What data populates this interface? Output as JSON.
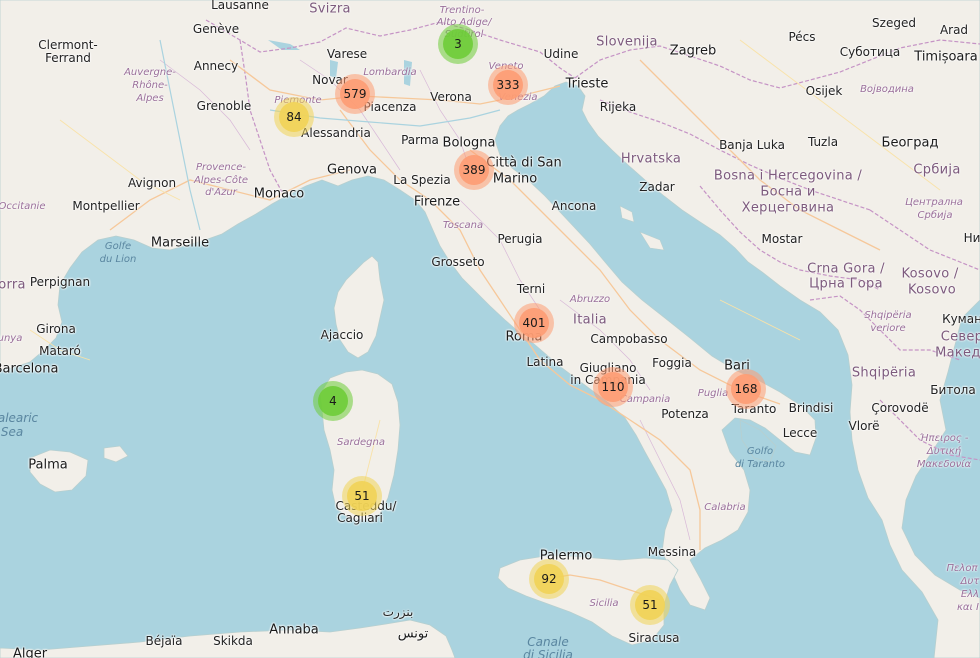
{
  "colors": {
    "sea": "#aad3df",
    "land": "#f2efe9",
    "cluster_small": "#6ecc39",
    "cluster_medium": "#f1d357",
    "cluster_large": "#fd9c73"
  },
  "clusters": [
    {
      "count": "3",
      "size": "small"
    },
    {
      "count": "579",
      "size": "large"
    },
    {
      "count": "333",
      "size": "large"
    },
    {
      "count": "84",
      "size": "medium"
    },
    {
      "count": "389",
      "size": "large"
    },
    {
      "count": "401",
      "size": "large"
    },
    {
      "count": "110",
      "size": "large"
    },
    {
      "count": "168",
      "size": "large"
    },
    {
      "count": "4",
      "size": "small"
    },
    {
      "count": "51",
      "size": "medium"
    },
    {
      "count": "92",
      "size": "medium"
    },
    {
      "count": "51",
      "size": "medium"
    }
  ],
  "countries": {
    "svizra": "Svizra",
    "slovenija": "Slovenija",
    "hrvatska": "Hrvatska",
    "italia": "Italia",
    "bosna_1": "Bosna i Hercegovina /",
    "bosna_2": "Босна и",
    "bosna_3": "Херцеговина",
    "srbija": "Србија",
    "crna_gora_1": "Crna Gora /",
    "crna_gora_2": "Црна Гора",
    "kosovo_1": "Kosovo /",
    "kosovo_2": "Kosovo",
    "shqiperia": "Shqipëria",
    "sever_1": "Север",
    "sever_2": "Македо"
  },
  "cities": {
    "lausanne": "Lausanne",
    "geneve": "Genève",
    "clermont_1": "Clermont-",
    "clermont_2": "Ferrand",
    "annecy": "Annecy",
    "grenoble": "Grenoble",
    "avignon": "Avignon",
    "montpellier": "Montpellier",
    "marseille": "Marseille",
    "monaco": "Monaco",
    "perpignan": "Perpignan",
    "girona": "Girona",
    "mataro": "Mataró",
    "barcelona": "Barcelona",
    "palma": "Palma",
    "varese": "Varese",
    "novara": "Novar",
    "piacenza": "Piacenza",
    "alessandria": "Alessandria",
    "genova": "Genova",
    "verona": "Verona",
    "parma": "Parma",
    "bologna": "Bologna",
    "la_spezia": "La Spezia",
    "firenze": "Firenze",
    "san_marino_1": "Città di San",
    "san_marino_2": "Marino",
    "udine": "Udine",
    "trieste": "Trieste",
    "rijeka": "Rijeka",
    "zagreb": "Zagreb",
    "pecs": "Pécs",
    "szeged": "Szeged",
    "arad": "Arad",
    "timisoara": "Timișoara",
    "subotica": "Суботица",
    "osijek": "Osijek",
    "beograd": "Београд",
    "banja_luka": "Banja Luka",
    "tuzla": "Tuzla",
    "zadar": "Zadar",
    "ancona": "Ancona",
    "perugia": "Perugia",
    "grosseto": "Grosseto",
    "terni": "Terni",
    "roma": "Roma",
    "latina": "Latina",
    "campobasso": "Campobasso",
    "foggia": "Foggia",
    "giugliano_1": "Giugliano",
    "giugliano_2": "in Campania",
    "bari": "Bari",
    "taranto": "Taranto",
    "brindisi": "Brindisi",
    "lecce": "Lecce",
    "potenza": "Potenza",
    "mostar": "Mostar",
    "ajaccio": "Ajaccio",
    "cagliari_1": "Casteddu/",
    "cagliari_2": "Cagliari",
    "palermo": "Palermo",
    "messina": "Messina",
    "siracusa": "Siracusa",
    "annaba": "Annaba",
    "bejaia": "Béjaïa",
    "skikda": "Skikda",
    "bizerte": "بنزرت",
    "tunis": "تونس",
    "vlore": "Vlorë",
    "corovode": "Çorovodë",
    "bitola": "Битола",
    "kumanovo": "Куман",
    "nis": "Ни",
    "algiers": "Alger"
  },
  "regions": {
    "trentino_1": "Trentino-",
    "trentino_2": "Alto Adige/",
    "trentino_3": "Südtirol",
    "lombardia": "Lombardia",
    "veneto_1": "Veneto",
    "veneto_2": "Venezia",
    "piemonte": "Piemonte",
    "auvergne_1": "Auvergne-",
    "auvergne_2": "Rhône-",
    "auvergne_3": "Alpes",
    "provence_1": "Provence-",
    "provence_2": "Alpes-Côte",
    "provence_3": "d'Azur",
    "occitanie": "Occitanie",
    "toscana": "Toscana",
    "abruzzo": "Abruzzo",
    "campania": "Campania",
    "calabria": "Calabria",
    "sardegna": "Sardegna",
    "sicilia": "Sicilia",
    "vojvodina": "Војводина",
    "centralna_1": "Централна",
    "centralna_2": "Србија",
    "shqiperia_verior_1": "Shqipëria",
    "shqiperia_verior_2": "veriore",
    "ipeiros_1": "Ήπειρος -",
    "ipeiros_2": "Δυτική",
    "ipeiros_3": "Μακεδονία",
    "pelop_1": "Πελοπ",
    "pelop_2": "Δυτ",
    "pelop_3": "Ελλ",
    "pelop_4": "και Ι",
    "puglia": "Puglia",
    "orra": "orra",
    "unya": "unya"
  },
  "seas": {
    "golfe_lion_1": "Golfe",
    "golfe_lion_2": "du Lion",
    "balearic_1": "alearic",
    "balearic_2": "Sea",
    "golfo_taranto_1": "Golfo",
    "golfo_taranto_2": "di Taranto",
    "canale_1": "Canale",
    "canale_2": "di Sicilia"
  }
}
